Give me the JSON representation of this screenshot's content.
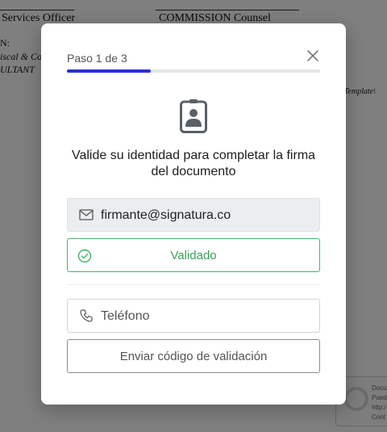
{
  "background_document": {
    "left_signer_title": "Services Officer",
    "right_signer_title": "COMMISSION Counsel",
    "left_lines": [
      "N:",
      "iscal & Co",
      "ULTANT"
    ],
    "right_path": "\\Template\\",
    "stamp_lines": [
      "Docu",
      "Pued",
      "http:/",
      "Cont"
    ]
  },
  "modal": {
    "step_label": "Paso 1 de 3",
    "progress_fraction": 0.33,
    "progress_color": "#2b2fd4",
    "close_icon": "close-icon",
    "id_icon": "id-badge-icon",
    "title": "Valide su identidad para completar la firma del documento",
    "email": {
      "icon": "envelope-icon",
      "value": "firmante@signatura.co"
    },
    "validated": {
      "icon": "check-circle-icon",
      "label": "Validado",
      "color": "#45b265"
    },
    "phone": {
      "icon": "phone-icon",
      "placeholder": "Teléfono"
    },
    "send_button_label": "Enviar código de validación"
  }
}
